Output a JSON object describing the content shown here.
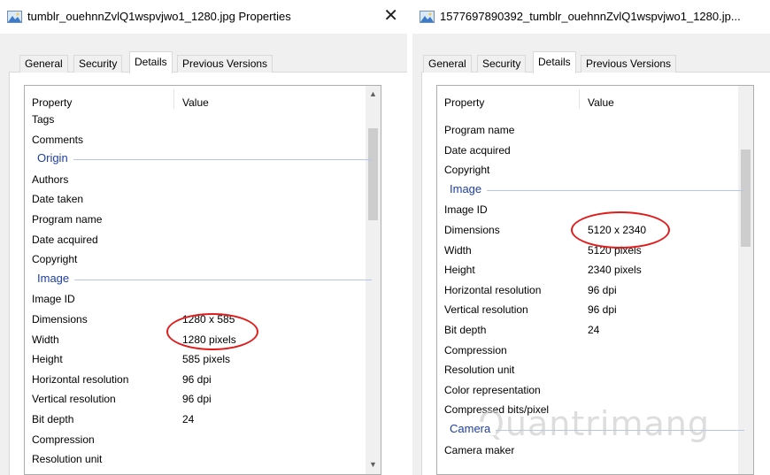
{
  "left_window": {
    "title": "tumblr_ouehnnZvlQ1wspvjwo1_1280.jpg Properties",
    "close": "✕",
    "tabs": [
      "General",
      "Security",
      "Details",
      "Previous Versions"
    ],
    "active_tab": "Details",
    "header": {
      "property": "Property",
      "value": "Value"
    },
    "items": [
      {
        "label": "Tags",
        "value": ""
      },
      {
        "label": "Comments",
        "value": ""
      },
      {
        "group": "Origin"
      },
      {
        "label": "Authors",
        "value": ""
      },
      {
        "label": "Date taken",
        "value": ""
      },
      {
        "label": "Program name",
        "value": ""
      },
      {
        "label": "Date acquired",
        "value": ""
      },
      {
        "label": "Copyright",
        "value": ""
      },
      {
        "group": "Image"
      },
      {
        "label": "Image ID",
        "value": ""
      },
      {
        "label": "Dimensions",
        "value": "1280 x 585"
      },
      {
        "label": "Width",
        "value": "1280 pixels"
      },
      {
        "label": "Height",
        "value": "585 pixels"
      },
      {
        "label": "Horizontal resolution",
        "value": "96 dpi"
      },
      {
        "label": "Vertical resolution",
        "value": "96 dpi"
      },
      {
        "label": "Bit depth",
        "value": "24"
      },
      {
        "label": "Compression",
        "value": ""
      },
      {
        "label": "Resolution unit",
        "value": ""
      }
    ]
  },
  "right_window": {
    "title": "1577697890392_tumblr_ouehnnZvlQ1wspvjwo1_1280.jp...",
    "tabs": [
      "General",
      "Security",
      "Details",
      "Previous Versions"
    ],
    "active_tab": "Details",
    "header": {
      "property": "Property",
      "value": "Value"
    },
    "items": [
      {
        "label": "Program name",
        "value": ""
      },
      {
        "label": "Date acquired",
        "value": ""
      },
      {
        "label": "Copyright",
        "value": ""
      },
      {
        "group": "Image"
      },
      {
        "label": "Image ID",
        "value": ""
      },
      {
        "label": "Dimensions",
        "value": "5120 x 2340"
      },
      {
        "label": "Width",
        "value": "5120 pixels"
      },
      {
        "label": "Height",
        "value": "2340 pixels"
      },
      {
        "label": "Horizontal resolution",
        "value": "96 dpi"
      },
      {
        "label": "Vertical resolution",
        "value": "96 dpi"
      },
      {
        "label": "Bit depth",
        "value": "24"
      },
      {
        "label": "Compression",
        "value": ""
      },
      {
        "label": "Resolution unit",
        "value": ""
      },
      {
        "label": "Color representation",
        "value": ""
      },
      {
        "label": "Compressed bits/pixel",
        "value": ""
      },
      {
        "group": "Camera"
      },
      {
        "label": "Camera maker",
        "value": ""
      }
    ]
  },
  "watermark": "Quantrimang",
  "colors": {
    "annotation": "#e01d1d",
    "group_header": "#1e3f9e"
  }
}
